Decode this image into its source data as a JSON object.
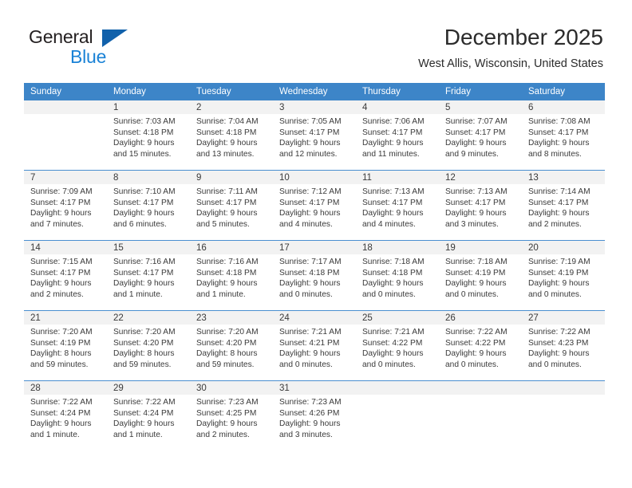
{
  "brand": {
    "name_part1": "General",
    "name_part2": "Blue",
    "triangle_color": "#1161ab",
    "blue_color": "#1a82d6"
  },
  "header": {
    "month_title": "December 2025",
    "location": "West Allis, Wisconsin, United States"
  },
  "theme": {
    "header_row_bg": "#3d85c8",
    "date_band_bg": "#f2f2f2",
    "week_divider": "#4a8fd0",
    "text_color": "#3a3a3a"
  },
  "weekday_headers": [
    "Sunday",
    "Monday",
    "Tuesday",
    "Wednesday",
    "Thursday",
    "Friday",
    "Saturday"
  ],
  "weeks": [
    [
      {
        "date": "",
        "sunrise": "",
        "sunset": "",
        "daylight_line1": "",
        "daylight_line2": ""
      },
      {
        "date": "1",
        "sunrise": "Sunrise: 7:03 AM",
        "sunset": "Sunset: 4:18 PM",
        "daylight_line1": "Daylight: 9 hours",
        "daylight_line2": "and 15 minutes."
      },
      {
        "date": "2",
        "sunrise": "Sunrise: 7:04 AM",
        "sunset": "Sunset: 4:18 PM",
        "daylight_line1": "Daylight: 9 hours",
        "daylight_line2": "and 13 minutes."
      },
      {
        "date": "3",
        "sunrise": "Sunrise: 7:05 AM",
        "sunset": "Sunset: 4:17 PM",
        "daylight_line1": "Daylight: 9 hours",
        "daylight_line2": "and 12 minutes."
      },
      {
        "date": "4",
        "sunrise": "Sunrise: 7:06 AM",
        "sunset": "Sunset: 4:17 PM",
        "daylight_line1": "Daylight: 9 hours",
        "daylight_line2": "and 11 minutes."
      },
      {
        "date": "5",
        "sunrise": "Sunrise: 7:07 AM",
        "sunset": "Sunset: 4:17 PM",
        "daylight_line1": "Daylight: 9 hours",
        "daylight_line2": "and 9 minutes."
      },
      {
        "date": "6",
        "sunrise": "Sunrise: 7:08 AM",
        "sunset": "Sunset: 4:17 PM",
        "daylight_line1": "Daylight: 9 hours",
        "daylight_line2": "and 8 minutes."
      }
    ],
    [
      {
        "date": "7",
        "sunrise": "Sunrise: 7:09 AM",
        "sunset": "Sunset: 4:17 PM",
        "daylight_line1": "Daylight: 9 hours",
        "daylight_line2": "and 7 minutes."
      },
      {
        "date": "8",
        "sunrise": "Sunrise: 7:10 AM",
        "sunset": "Sunset: 4:17 PM",
        "daylight_line1": "Daylight: 9 hours",
        "daylight_line2": "and 6 minutes."
      },
      {
        "date": "9",
        "sunrise": "Sunrise: 7:11 AM",
        "sunset": "Sunset: 4:17 PM",
        "daylight_line1": "Daylight: 9 hours",
        "daylight_line2": "and 5 minutes."
      },
      {
        "date": "10",
        "sunrise": "Sunrise: 7:12 AM",
        "sunset": "Sunset: 4:17 PM",
        "daylight_line1": "Daylight: 9 hours",
        "daylight_line2": "and 4 minutes."
      },
      {
        "date": "11",
        "sunrise": "Sunrise: 7:13 AM",
        "sunset": "Sunset: 4:17 PM",
        "daylight_line1": "Daylight: 9 hours",
        "daylight_line2": "and 4 minutes."
      },
      {
        "date": "12",
        "sunrise": "Sunrise: 7:13 AM",
        "sunset": "Sunset: 4:17 PM",
        "daylight_line1": "Daylight: 9 hours",
        "daylight_line2": "and 3 minutes."
      },
      {
        "date": "13",
        "sunrise": "Sunrise: 7:14 AM",
        "sunset": "Sunset: 4:17 PM",
        "daylight_line1": "Daylight: 9 hours",
        "daylight_line2": "and 2 minutes."
      }
    ],
    [
      {
        "date": "14",
        "sunrise": "Sunrise: 7:15 AM",
        "sunset": "Sunset: 4:17 PM",
        "daylight_line1": "Daylight: 9 hours",
        "daylight_line2": "and 2 minutes."
      },
      {
        "date": "15",
        "sunrise": "Sunrise: 7:16 AM",
        "sunset": "Sunset: 4:17 PM",
        "daylight_line1": "Daylight: 9 hours",
        "daylight_line2": "and 1 minute."
      },
      {
        "date": "16",
        "sunrise": "Sunrise: 7:16 AM",
        "sunset": "Sunset: 4:18 PM",
        "daylight_line1": "Daylight: 9 hours",
        "daylight_line2": "and 1 minute."
      },
      {
        "date": "17",
        "sunrise": "Sunrise: 7:17 AM",
        "sunset": "Sunset: 4:18 PM",
        "daylight_line1": "Daylight: 9 hours",
        "daylight_line2": "and 0 minutes."
      },
      {
        "date": "18",
        "sunrise": "Sunrise: 7:18 AM",
        "sunset": "Sunset: 4:18 PM",
        "daylight_line1": "Daylight: 9 hours",
        "daylight_line2": "and 0 minutes."
      },
      {
        "date": "19",
        "sunrise": "Sunrise: 7:18 AM",
        "sunset": "Sunset: 4:19 PM",
        "daylight_line1": "Daylight: 9 hours",
        "daylight_line2": "and 0 minutes."
      },
      {
        "date": "20",
        "sunrise": "Sunrise: 7:19 AM",
        "sunset": "Sunset: 4:19 PM",
        "daylight_line1": "Daylight: 9 hours",
        "daylight_line2": "and 0 minutes."
      }
    ],
    [
      {
        "date": "21",
        "sunrise": "Sunrise: 7:20 AM",
        "sunset": "Sunset: 4:19 PM",
        "daylight_line1": "Daylight: 8 hours",
        "daylight_line2": "and 59 minutes."
      },
      {
        "date": "22",
        "sunrise": "Sunrise: 7:20 AM",
        "sunset": "Sunset: 4:20 PM",
        "daylight_line1": "Daylight: 8 hours",
        "daylight_line2": "and 59 minutes."
      },
      {
        "date": "23",
        "sunrise": "Sunrise: 7:20 AM",
        "sunset": "Sunset: 4:20 PM",
        "daylight_line1": "Daylight: 8 hours",
        "daylight_line2": "and 59 minutes."
      },
      {
        "date": "24",
        "sunrise": "Sunrise: 7:21 AM",
        "sunset": "Sunset: 4:21 PM",
        "daylight_line1": "Daylight: 9 hours",
        "daylight_line2": "and 0 minutes."
      },
      {
        "date": "25",
        "sunrise": "Sunrise: 7:21 AM",
        "sunset": "Sunset: 4:22 PM",
        "daylight_line1": "Daylight: 9 hours",
        "daylight_line2": "and 0 minutes."
      },
      {
        "date": "26",
        "sunrise": "Sunrise: 7:22 AM",
        "sunset": "Sunset: 4:22 PM",
        "daylight_line1": "Daylight: 9 hours",
        "daylight_line2": "and 0 minutes."
      },
      {
        "date": "27",
        "sunrise": "Sunrise: 7:22 AM",
        "sunset": "Sunset: 4:23 PM",
        "daylight_line1": "Daylight: 9 hours",
        "daylight_line2": "and 0 minutes."
      }
    ],
    [
      {
        "date": "28",
        "sunrise": "Sunrise: 7:22 AM",
        "sunset": "Sunset: 4:24 PM",
        "daylight_line1": "Daylight: 9 hours",
        "daylight_line2": "and 1 minute."
      },
      {
        "date": "29",
        "sunrise": "Sunrise: 7:22 AM",
        "sunset": "Sunset: 4:24 PM",
        "daylight_line1": "Daylight: 9 hours",
        "daylight_line2": "and 1 minute."
      },
      {
        "date": "30",
        "sunrise": "Sunrise: 7:23 AM",
        "sunset": "Sunset: 4:25 PM",
        "daylight_line1": "Daylight: 9 hours",
        "daylight_line2": "and 2 minutes."
      },
      {
        "date": "31",
        "sunrise": "Sunrise: 7:23 AM",
        "sunset": "Sunset: 4:26 PM",
        "daylight_line1": "Daylight: 9 hours",
        "daylight_line2": "and 3 minutes."
      },
      {
        "date": "",
        "sunrise": "",
        "sunset": "",
        "daylight_line1": "",
        "daylight_line2": ""
      },
      {
        "date": "",
        "sunrise": "",
        "sunset": "",
        "daylight_line1": "",
        "daylight_line2": ""
      },
      {
        "date": "",
        "sunrise": "",
        "sunset": "",
        "daylight_line1": "",
        "daylight_line2": ""
      }
    ]
  ]
}
